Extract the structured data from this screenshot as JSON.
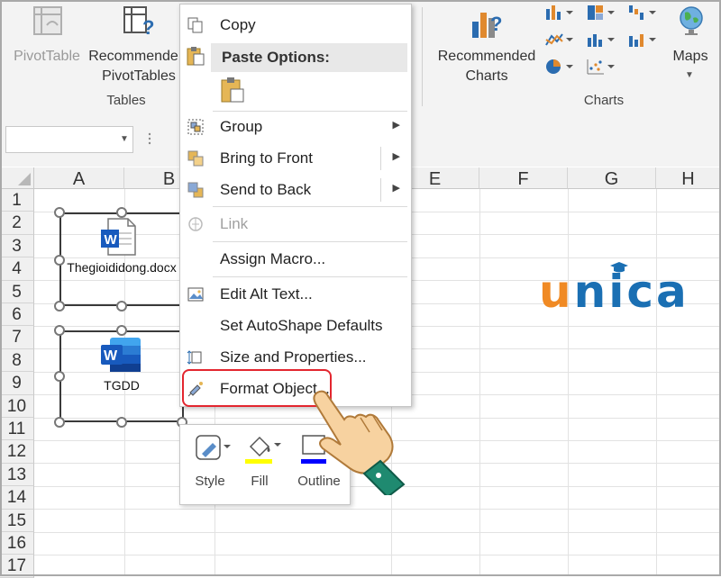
{
  "ribbon": {
    "pivottable_label": "PivotTable",
    "recommended_pivottables_label_1": "Recommende",
    "recommended_pivottables_label_2": "PivotTables",
    "tables_group": "Tables",
    "recommended_charts_label_1": "Recommended",
    "recommended_charts_label_2": "Charts",
    "maps_label": "Maps",
    "charts_group": "Charts"
  },
  "grid": {
    "columns": [
      "A",
      "B",
      "E",
      "F",
      "G",
      "H"
    ],
    "rows": [
      "1",
      "2",
      "3",
      "4",
      "5",
      "6",
      "7",
      "8",
      "9",
      "10",
      "11",
      "12",
      "13",
      "14",
      "15",
      "16",
      "17"
    ]
  },
  "objects": {
    "doc1_label": "Thegioididong.docx",
    "doc2_label": "TGDD",
    "word_letter": "W"
  },
  "context_menu": {
    "copy": "Copy",
    "paste_options": "Paste Options:",
    "group": "Group",
    "bring_to_front": "Bring to Front",
    "send_to_back": "Send to Back",
    "link": "Link",
    "assign_macro": "Assign Macro...",
    "edit_alt_text": "Edit Alt Text...",
    "set_autoshape_defaults": "Set AutoShape Defaults",
    "size_and_properties": "Size and Properties...",
    "format_object": "Format Object..."
  },
  "mini_toolbar": {
    "style": "Style",
    "fill": "Fill",
    "outline": "Outline"
  },
  "logo": {
    "letter_u": "u",
    "letters_nica": "nica",
    "color_u": "#f08a24",
    "color_nica": "#1a6fb3"
  },
  "colors": {
    "highlight": "#e3262f",
    "word_blue": "#185abd",
    "fill_yellow": "#ffff00",
    "outline_blue": "#0000ff"
  }
}
